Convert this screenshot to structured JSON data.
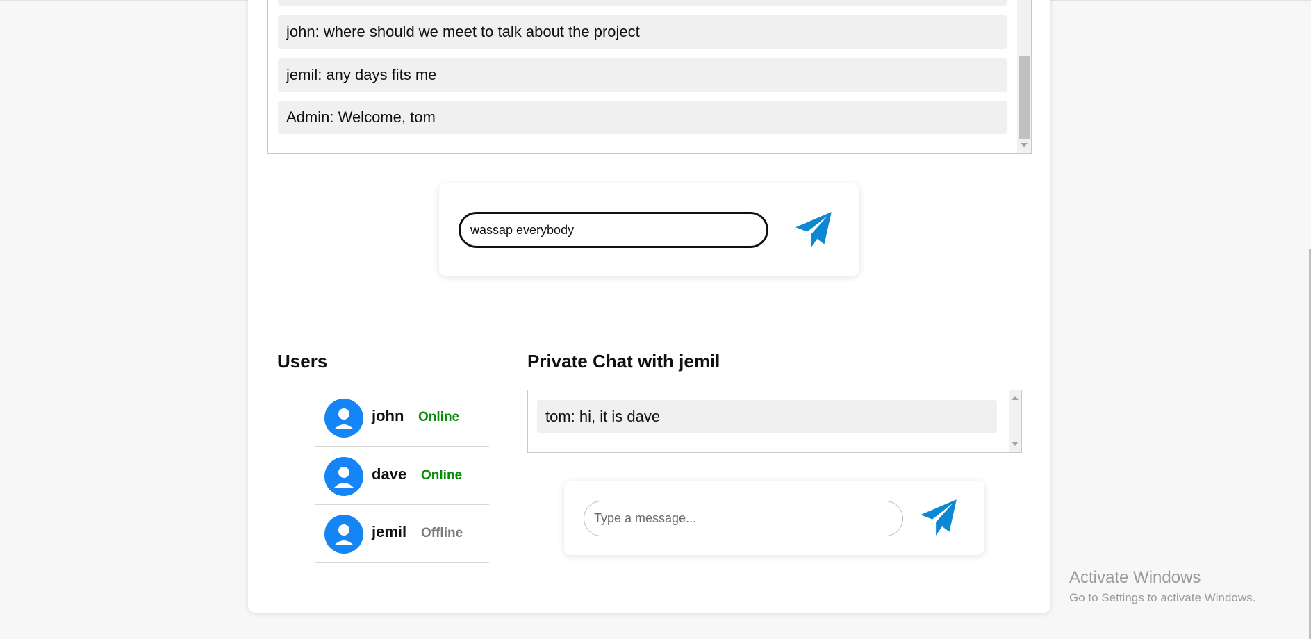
{
  "public_chat": {
    "messages": [
      "john: where should we meet to talk about the project",
      "jemil: any days fits me",
      "Admin: Welcome, tom"
    ],
    "input_value": "wassap everybody",
    "send_icon": "paper-plane-icon"
  },
  "users": {
    "title": "Users",
    "list": [
      {
        "name": "john",
        "status": "Online"
      },
      {
        "name": "dave",
        "status": "Online"
      },
      {
        "name": "jemil",
        "status": "Offline"
      }
    ],
    "avatar_icon": "user-avatar-icon"
  },
  "private_chat": {
    "title": "Private Chat with jemil",
    "messages": [
      "tom: hi, it is dave"
    ],
    "input_placeholder": "Type a message...",
    "send_icon": "paper-plane-icon"
  },
  "colors": {
    "accent_blue": "#1585f5",
    "send_blue": "#0b87d4",
    "online_green": "#0a8a0a",
    "offline_gray": "#7a7a7a"
  },
  "watermark": {
    "title": "Activate Windows",
    "subtitle": "Go to Settings to activate Windows."
  }
}
